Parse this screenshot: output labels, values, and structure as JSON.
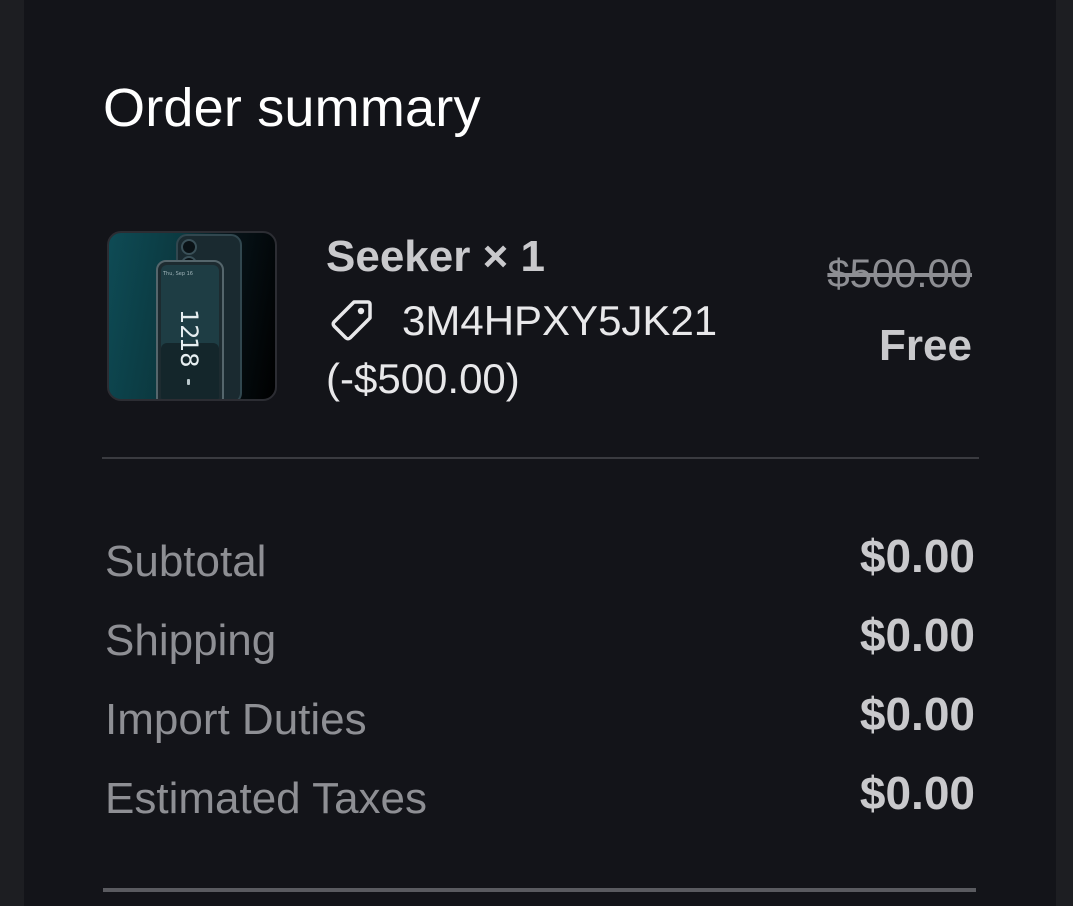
{
  "order_summary": {
    "title": "Order summary",
    "item": {
      "name": "Seeker × 1",
      "discount_code": "3M4HPXY5JK21",
      "discount_amount": "(-$500.00)",
      "original_price": "$500.00",
      "final_price": "Free",
      "image_icon": "phone-product-image",
      "image_text": {
        "hour": "12",
        "minute": "18"
      }
    },
    "tag_icon": "tag-icon",
    "rows": [
      {
        "label": "Subtotal",
        "value": "$0.00"
      },
      {
        "label": "Shipping",
        "value": "$0.00"
      },
      {
        "label": "Import Duties",
        "value": "$0.00"
      },
      {
        "label": "Estimated Taxes",
        "value": "$0.00"
      }
    ]
  },
  "colors": {
    "background": "#131419",
    "title_text": "#ffffff",
    "label_text": "#8e8f94",
    "value_text": "#c9c9cc",
    "divider": "#3a3b40"
  }
}
